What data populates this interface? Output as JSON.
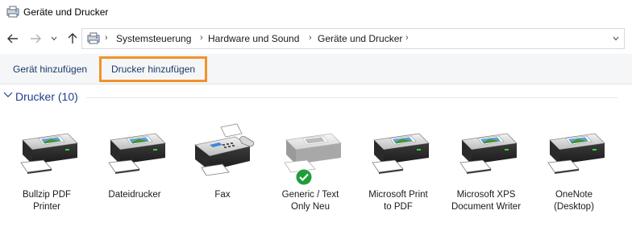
{
  "window": {
    "title": "Geräte und Drucker"
  },
  "address": {
    "crumbs": [
      "Systemsteuerung",
      "Hardware und Sound",
      "Geräte und Drucker"
    ]
  },
  "commands": {
    "add_device": "Gerät hinzufügen",
    "add_printer": "Drucker hinzufügen"
  },
  "group": {
    "title": "Drucker (10)"
  },
  "devices": [
    {
      "line1": "Bullzip PDF",
      "line2": "Printer",
      "icon": "printer-icon"
    },
    {
      "line1": "Dateidrucker",
      "line2": "",
      "icon": "printer-icon"
    },
    {
      "line1": "Fax",
      "line2": "",
      "icon": "fax-icon"
    },
    {
      "line1": "Generic / Text",
      "line2": "Only Neu",
      "icon": "printer-default-icon"
    },
    {
      "line1": "Microsoft Print",
      "line2": "to PDF",
      "icon": "printer-icon"
    },
    {
      "line1": "Microsoft XPS",
      "line2": "Document Writer",
      "icon": "printer-icon"
    },
    {
      "line1": "OneNote",
      "line2": "(Desktop)",
      "icon": "printer-icon"
    }
  ],
  "colors": {
    "highlight": "#f0932b",
    "group_title": "#1e3d8f",
    "command_bar": "#f5f6f7",
    "default_badge": "#1e9e3a"
  }
}
